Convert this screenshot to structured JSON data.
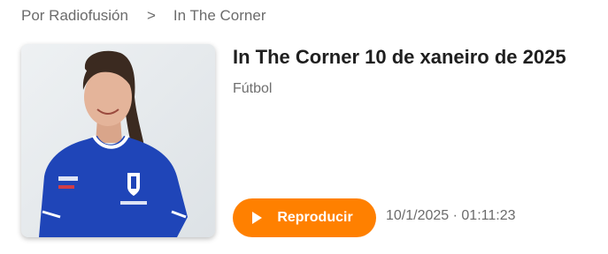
{
  "breadcrumb": {
    "parent": "Por Radiofusión",
    "separator": ">",
    "current": "In The Corner"
  },
  "episode": {
    "title": "In The Corner 10 de xaneiro de 2025",
    "category": "Fútbol",
    "play_label": "Reproducir",
    "meta": "10/1/2025 · 01:11:23"
  },
  "colors": {
    "accent": "#ff8000",
    "text_primary": "#1f1f1f",
    "text_secondary": "#6b6b6b",
    "jersey": "#1f45b8"
  },
  "icons": {
    "play": "play-icon",
    "separator": "chevron-right-icon"
  }
}
